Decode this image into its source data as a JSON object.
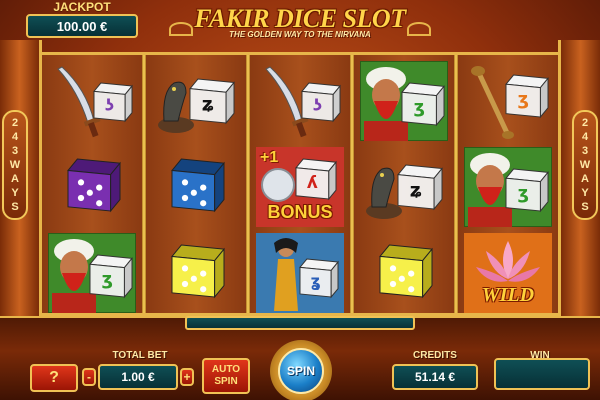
{
  "jackpot": {
    "label": "JACKPOT",
    "value": "100.00 €"
  },
  "title": {
    "main": "FAKIR DICE SLOT",
    "sub": "THE GOLDEN WAY TO THE NIRVANA"
  },
  "ways": {
    "left": [
      "2",
      "4",
      "3",
      "W",
      "A",
      "Y",
      "S"
    ],
    "right": [
      "2",
      "4",
      "3",
      "W",
      "A",
      "Y",
      "S"
    ]
  },
  "reels": [
    [
      "dagger",
      "dice-purple",
      "fakir-dice"
    ],
    [
      "cobra-dice",
      "dice-blue",
      "dice-yellow"
    ],
    [
      "dagger",
      "bonus",
      "dancer-dice"
    ],
    [
      "fakir-dice",
      "cobra-dice",
      "dice-yellow"
    ],
    [
      "flute-dice",
      "fakir-dice",
      "lotus-wild"
    ]
  ],
  "symbols": {
    "bonus": {
      "plus": "+1",
      "text": "BONUS"
    },
    "wild": {
      "text": "WILD"
    }
  },
  "controls": {
    "help_label": "?",
    "minus_label": "-",
    "plus_label": "+",
    "total_bet_label": "TOTAL BET",
    "total_bet_value": "1.00 €",
    "auto_spin_line1": "AUTO",
    "auto_spin_line2": "SPIN",
    "spin_label": "SPIN",
    "credits_label": "CREDITS",
    "credits_value": "51.14 €",
    "win_label": "WIN",
    "win_value": ""
  },
  "colors": {
    "gold": "#f0c255",
    "teal_box": "#0f4f55",
    "red_button": "#e0361a",
    "spin_blue": "#1b7fc8"
  }
}
